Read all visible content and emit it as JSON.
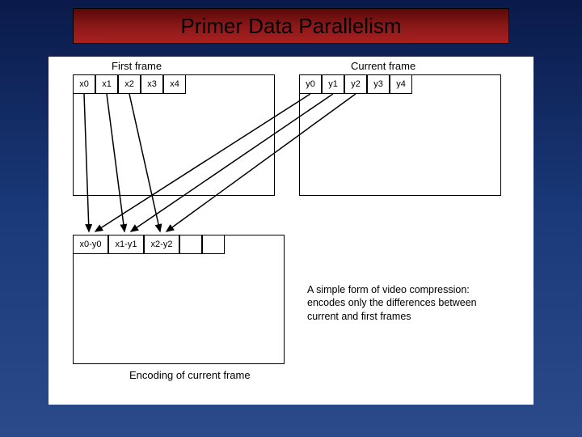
{
  "title": "Primer Data Parallelism",
  "frames": {
    "first": {
      "label": "First frame",
      "cells": [
        "x0",
        "x1",
        "x2",
        "x3",
        "x4"
      ]
    },
    "current": {
      "label": "Current frame",
      "cells": [
        "y0",
        "y1",
        "y2",
        "y3",
        "y4"
      ]
    },
    "encoding": {
      "label": "Encoding of current frame",
      "cells": [
        "x0-y0",
        "x1-y1",
        "x2-y2",
        "",
        ""
      ]
    }
  },
  "caption": {
    "line1": "A simple form of video compression:",
    "line2": "encodes only the differences between",
    "line3": "current and first frames"
  }
}
